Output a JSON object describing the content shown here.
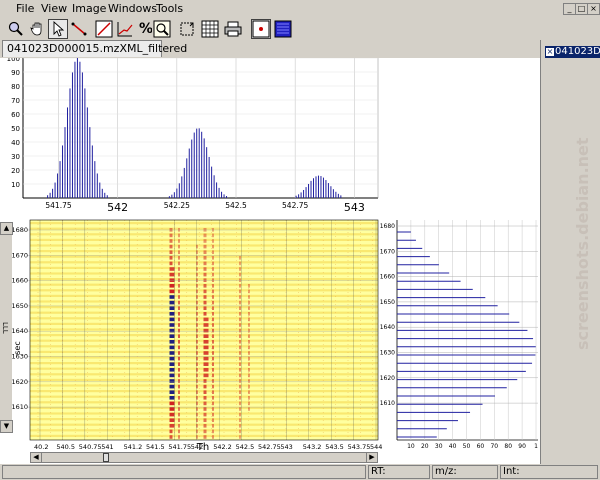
{
  "menubar": {
    "items": [
      "File",
      "View",
      "Image",
      "Windows",
      "Tools"
    ],
    "window_controls": [
      "_",
      "□",
      "×"
    ]
  },
  "toolbar": {
    "percent_label": "%",
    "buttons": [
      "zoom",
      "pan",
      "select",
      "measure",
      "draw-spectrum",
      "graph",
      "percent",
      "zoom-region",
      "fit",
      "grid",
      "print",
      "overlay",
      "colormap"
    ]
  },
  "tab": {
    "label": "041023D000015.mzXML_filtered"
  },
  "right_panel": {
    "selected_item": "041023D"
  },
  "top_chart": {
    "ylabels": [
      "100",
      "90",
      "80",
      "70",
      "60",
      "50",
      "40",
      "30",
      "20",
      "10"
    ],
    "xlabels_small": [
      "541.75",
      "542.25",
      "542.5",
      "542.75"
    ],
    "xlabels_big": [
      "542",
      "543"
    ]
  },
  "heatmap": {
    "ylabel": "sec",
    "xlabel": "Th",
    "ylabels": [
      "1680",
      "1670",
      "1660",
      "1650",
      "1640",
      "1630",
      "1620",
      "1610"
    ],
    "xlabels": [
      "40.2",
      "540.5",
      "540.75",
      "541",
      "541.2",
      "541.5",
      "541.75",
      "542",
      "542.2",
      "542.5",
      "542.75",
      "543",
      "543.2",
      "543.5",
      "543.75",
      "544"
    ]
  },
  "right_chart": {
    "ylabels": [
      "1680",
      "1670",
      "1660",
      "1650",
      "1640",
      "1630",
      "1620",
      "1610"
    ],
    "xlabels": [
      "10",
      "20",
      "30",
      "40",
      "50",
      "60",
      "70",
      "80",
      "90",
      "1"
    ]
  },
  "left_scroll": {
    "label": "LLL"
  },
  "statusbar": {
    "rt_label": "RT:",
    "mz_label": "m/z:",
    "int_label": "Int:"
  },
  "watermark": {
    "text": "screenshots.debian.net"
  },
  "chart_data": {
    "type": "bar",
    "xlim": [
      541.6,
      543.1
    ],
    "ylim": [
      0,
      100
    ],
    "title": "",
    "xlabel": "",
    "ylabel": "",
    "peaks": [
      {
        "mz": 541.83,
        "intensity": 100
      },
      {
        "mz": 542.34,
        "intensity": 50
      },
      {
        "mz": 542.85,
        "intensity": 16
      }
    ]
  },
  "colors": {
    "spectrum_line": "#2020a0",
    "heat_bg": "#ffffa0",
    "heat_stripe": "#f7e060",
    "hot_red": "#d02020",
    "hot_blue": "#202080",
    "selection": "#0a246a"
  }
}
